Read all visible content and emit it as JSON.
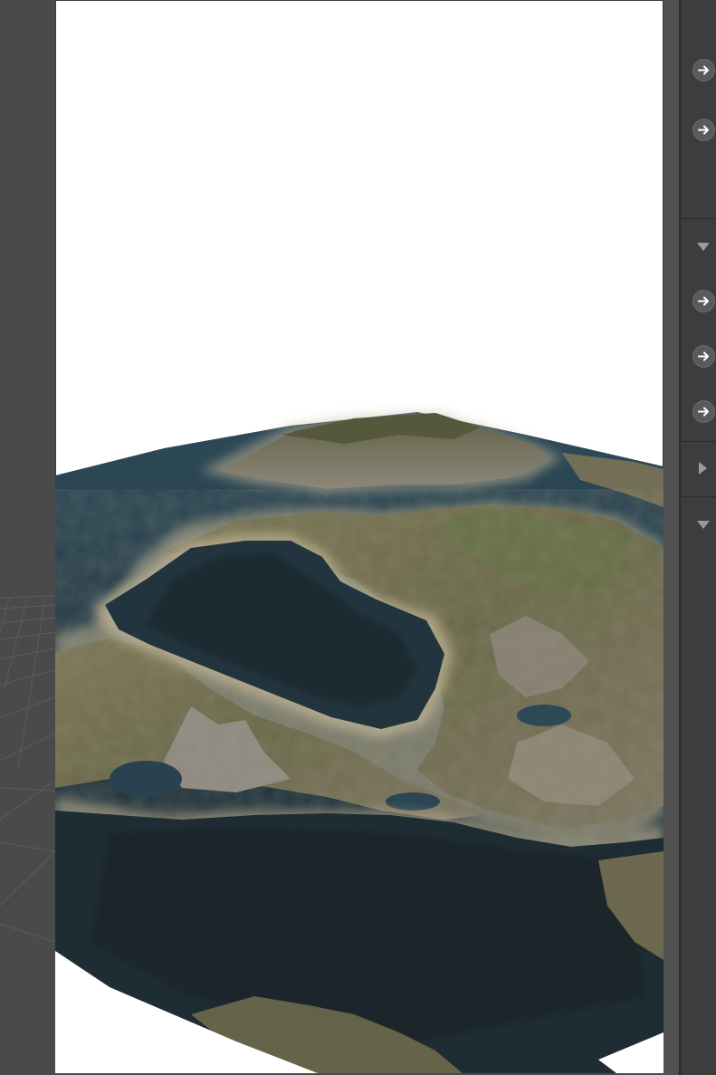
{
  "viewport": {
    "background_color": "#4a4a4a",
    "grid_color": "#5c5c5c"
  },
  "render_view": {
    "sky_color": "#ffffff",
    "water_deep_color": "#1c2a31",
    "water_mid_color": "#2b4552",
    "shore_color": "#8c8466",
    "land_color": "#6e6a4c",
    "mountain_color": "#8a8578"
  },
  "panel": {
    "background_color": "#3d3d3d",
    "icons": [
      {
        "name": "arrow-right-icon",
        "kind": "circle-arrow"
      },
      {
        "name": "arrow-right-icon",
        "kind": "circle-arrow"
      },
      {
        "name": "triangle-down-icon",
        "kind": "triangle-down"
      },
      {
        "name": "arrow-right-icon",
        "kind": "circle-arrow"
      },
      {
        "name": "arrow-right-icon",
        "kind": "circle-arrow"
      },
      {
        "name": "arrow-right-icon",
        "kind": "circle-arrow"
      },
      {
        "name": "triangle-right-icon",
        "kind": "triangle-right"
      },
      {
        "name": "triangle-down-icon",
        "kind": "triangle-down"
      }
    ]
  }
}
